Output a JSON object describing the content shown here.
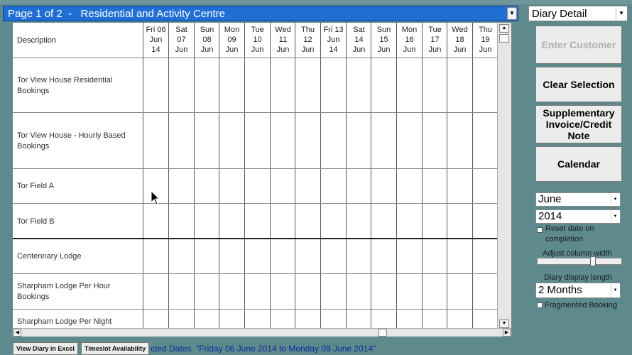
{
  "page_selector": {
    "value": "Page 1 of 2  -   Residential and Activity Centre"
  },
  "view_selector": {
    "value": "Diary Detail"
  },
  "grid": {
    "description_header": "Description",
    "days": [
      {
        "dow": "Fri 06",
        "day": "Jun",
        "mon": "14"
      },
      {
        "dow": "Sat",
        "day": "07",
        "mon": "Jun"
      },
      {
        "dow": "Sun",
        "day": "08",
        "mon": "Jun"
      },
      {
        "dow": "Mon",
        "day": "09",
        "mon": "Jun"
      },
      {
        "dow": "Tue",
        "day": "10",
        "mon": "Jun"
      },
      {
        "dow": "Wed",
        "day": "11",
        "mon": "Jun"
      },
      {
        "dow": "Thu",
        "day": "12",
        "mon": "Jun"
      },
      {
        "dow": "Fri 13",
        "day": "Jun",
        "mon": "14"
      },
      {
        "dow": "Sat",
        "day": "14",
        "mon": "Jun"
      },
      {
        "dow": "Sun",
        "day": "15",
        "mon": "Jun"
      },
      {
        "dow": "Mon",
        "day": "16",
        "mon": "Jun"
      },
      {
        "dow": "Tue",
        "day": "17",
        "mon": "Jun"
      },
      {
        "dow": "Wed",
        "day": "18",
        "mon": "Jun"
      },
      {
        "dow": "Thu",
        "day": "19",
        "mon": "Jun"
      }
    ],
    "rows": [
      {
        "line1": "Tor View House Residential",
        "line2": "Bookings"
      },
      {
        "line1": "Tor View House - Hourly Based",
        "line2": "Bookings"
      },
      {
        "line1": "Tor Field A",
        "line2": ""
      },
      {
        "line1": "Tor Field B",
        "line2": ""
      },
      {
        "line1": "Centennary Lodge",
        "line2": ""
      },
      {
        "line1": "Sharpham Lodge Per Hour",
        "line2": "Bookings"
      },
      {
        "line1": "Sharpham Lodge  Per Night",
        "line2": ""
      }
    ]
  },
  "sidebar": {
    "enter_customer": "Enter Customer",
    "clear_selection": "Clear Selection",
    "supplementary_l1": "Supplementary",
    "supplementary_l2": "Invoice/Credit",
    "supplementary_l3": "Note",
    "calendar": "Calendar",
    "month": "June",
    "year": "2014",
    "reset_date_l1": "Reset date on",
    "reset_date_l2": "completion",
    "adjust_width": "Adjust column width",
    "diary_length_label": "Diary display length",
    "diary_length_value": "2 Months",
    "fragmented": "Fragmented Booking"
  },
  "footer": {
    "view_excel": "View Diary in Excel",
    "timeslot": "Timeslot Availability",
    "selected_dates": "cted Dates  \"Friday 06 June 2014 to Monday 09 June 2014\""
  },
  "colors": {
    "background": "#5e8a8e",
    "accent": "#1f6fd4",
    "footer_text": "#0d2a9c"
  }
}
